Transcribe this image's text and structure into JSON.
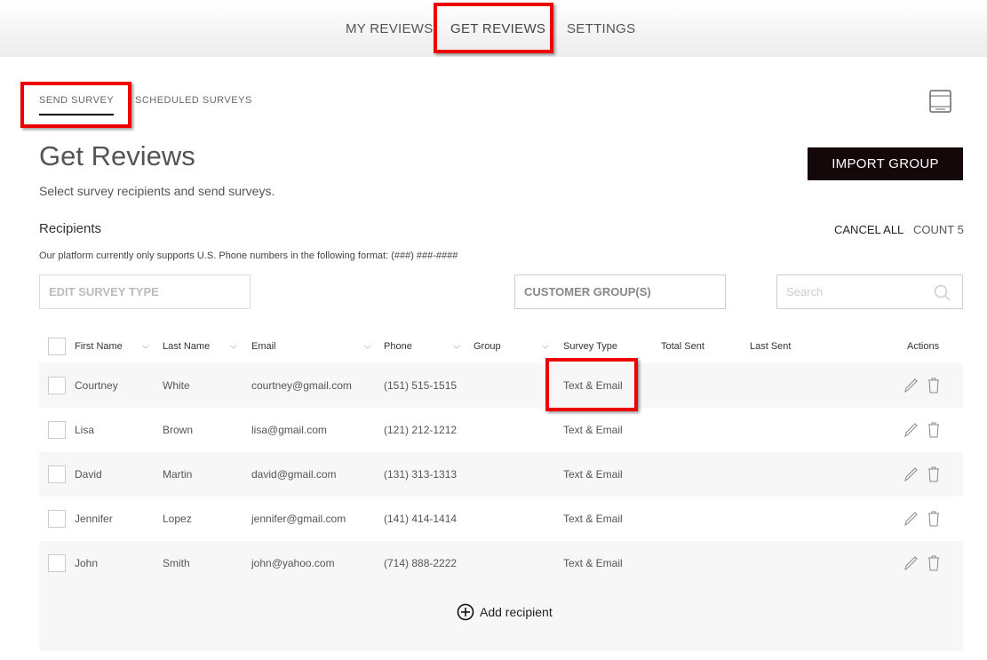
{
  "nav": {
    "items": [
      "MY REVIEWS",
      "GET REVIEWS",
      "SETTINGS"
    ],
    "active": "GET REVIEWS"
  },
  "subtabs": {
    "items": [
      "SEND SURVEY",
      "SCHEDULED SURVEYS"
    ],
    "active": "SEND SURVEY"
  },
  "page": {
    "title": "Get Reviews",
    "subtitle": "Select survey recipients and send surveys.",
    "import_label": "IMPORT GROUP"
  },
  "recipients": {
    "heading": "Recipients",
    "cancel_all": "CANCEL ALL",
    "count": "COUNT 5",
    "note": "Our platform currently only supports U.S. Phone numbers in the following format: (###) ###-####"
  },
  "filters": {
    "survey_type": "EDIT SURVEY TYPE",
    "customer_groups": "CUSTOMER GROUP(S)",
    "search_placeholder": "Search"
  },
  "table": {
    "headers": [
      "First Name",
      "Last Name",
      "Email",
      "Phone",
      "Group",
      "Survey Type",
      "Total Sent",
      "Last Sent",
      "Actions"
    ],
    "rows": [
      {
        "first": "Courtney",
        "last": "White",
        "email": "courtney@gmail.com",
        "phone": "(151) 515-1515",
        "group": "",
        "survey": "Text & Email",
        "total": "",
        "last_sent": ""
      },
      {
        "first": "Lisa",
        "last": "Brown",
        "email": "lisa@gmail.com",
        "phone": "(121) 212-1212",
        "group": "",
        "survey": "Text & Email",
        "total": "",
        "last_sent": ""
      },
      {
        "first": "David",
        "last": "Martin",
        "email": "david@gmail.com",
        "phone": "(131) 313-1313",
        "group": "",
        "survey": "Text & Email",
        "total": "",
        "last_sent": ""
      },
      {
        "first": "Jennifer",
        "last": "Lopez",
        "email": "jennifer@gmail.com",
        "phone": "(141) 414-1414",
        "group": "",
        "survey": "Text & Email",
        "total": "",
        "last_sent": ""
      },
      {
        "first": "John",
        "last": "Smith",
        "email": "john@yahoo.com",
        "phone": "(714) 888-2222",
        "group": "",
        "survey": "Text & Email",
        "total": "",
        "last_sent": ""
      }
    ],
    "add_label": "Add recipient"
  }
}
